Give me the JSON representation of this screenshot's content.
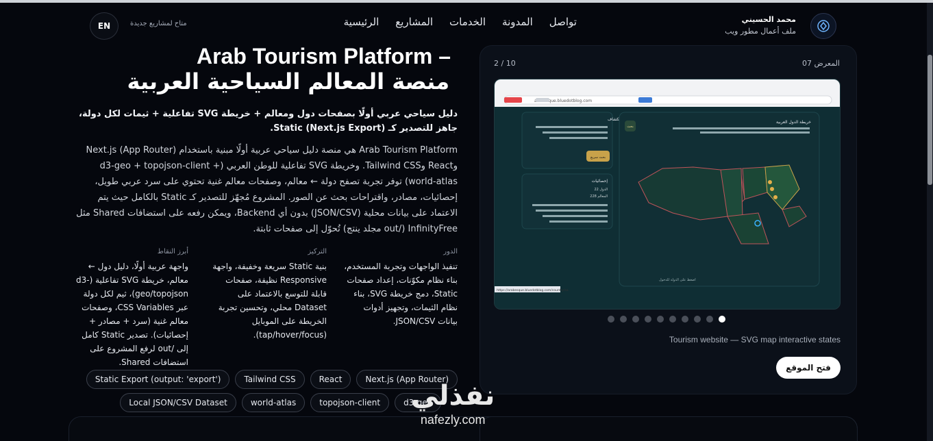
{
  "header": {
    "brand_name": "محمد الحسيني",
    "brand_sub": "ملف أعمال مطور ويب",
    "nav": [
      "الرئيسية",
      "المشاريع",
      "الخدمات",
      "المدونة",
      "تواصل"
    ],
    "availability": "متاح لمشاريع جديدة",
    "lang_button": "EN"
  },
  "project": {
    "title_en": "Arab Tourism Platform –",
    "title_ar": "منصة المعالم السياحية العربية",
    "summary": "دليل سياحي عربي أولًا بصفحات دول ومعالم + خريطة SVG تفاعلية + ثيمات لكل دولة، جاهز للتصدير كـ Static (Next.js Export).",
    "description": "Arab Tourism Platform هي منصة دليل سياحي عربية أولًا مبنية باستخدام Next.js (App Router) وReact وTailwind CSS. وخريطة SVG تفاعلية للوطن العربي (d3-geo + topojson-client + world-atlas) توفر تجربة تصفح دولة ← معالم، وصفحات معالم غنية تحتوي على سرد عربي طويل، إحصائيات، مصادر، واقتراحات بحث عن الصور. المشروع مُجهّز للتصدير كـ Static بالكامل حيث يتم الاعتماد على بيانات محلية (JSON/CSV) بدون أي Backend، ويمكن رفعه على استضافات Shared مثل InfinityFree (/out مجلد ينتج) تُحوّل إلى صفحات ثابتة."
  },
  "columns": [
    {
      "heading": "الدور",
      "text": "تنفيذ الواجهات وتجربة المستخدم، بناء نظام مكوّنات، إعداد صفحات Static، دمج خريطة SVG، بناء نظام الثيمات، وتجهيز أدوات بيانات JSON/CSV."
    },
    {
      "heading": "التركيز",
      "text": "بنية Static سريعة وخفيفة، واجهة Responsive نظيفة، صفحات قابلة للتوسع بالاعتماد على Dataset محلي، وتحسين تجربة الخريطة على الموبايل (tap/hover/focus)."
    },
    {
      "heading": "أبرز النقاط",
      "text": "واجهة عربية أولًا، دليل دول ← معالم، خريطة SVG تفاعلية (d3-geo/topojson)، ثيم لكل دولة عبر CSS Variables، وصفحات معالم غنية (سرد + مصادر + إحصائيات). تصدير Static كامل إلى /out لرفع المشروع على استضافات Shared."
    }
  ],
  "tags_row1": [
    "Next.js (App Router)",
    "React",
    "Tailwind CSS",
    "Static Export (output: 'export')"
  ],
  "tags_row2": [
    "d3-geo",
    "topojson-client",
    "world-atlas",
    "Local JSON/CSV Dataset"
  ],
  "gallery": {
    "label": "المعرض 07",
    "counter": "2 / 10",
    "dots_total": 10,
    "active_dot": 9,
    "caption": "Tourism website — SVG map interactive states",
    "open_button": "فتح الموقع",
    "screenshot": {
      "url": "arabesque.bluedotblog.com",
      "map_title": "خريطة الدول العربية",
      "side_title": "ابدأ الاستكشاف",
      "side_button": "بحث سريع",
      "stats_title": "إحصائيات",
      "stats_countries": "الدول 22",
      "stats_places": "المعالم 228",
      "map_button": "بحث",
      "footer_link": "اضغط على الدولة للدخول",
      "status_url": "https://arabesque.bluedotblog.com/country/sa"
    }
  },
  "watermark": {
    "ar": "نفذلي",
    "en": "nafezly.com"
  },
  "colors": {
    "background": "#05070d",
    "card": "#0b1019",
    "accent": "#6fb6ff",
    "map_bg": "#0e2a30"
  }
}
